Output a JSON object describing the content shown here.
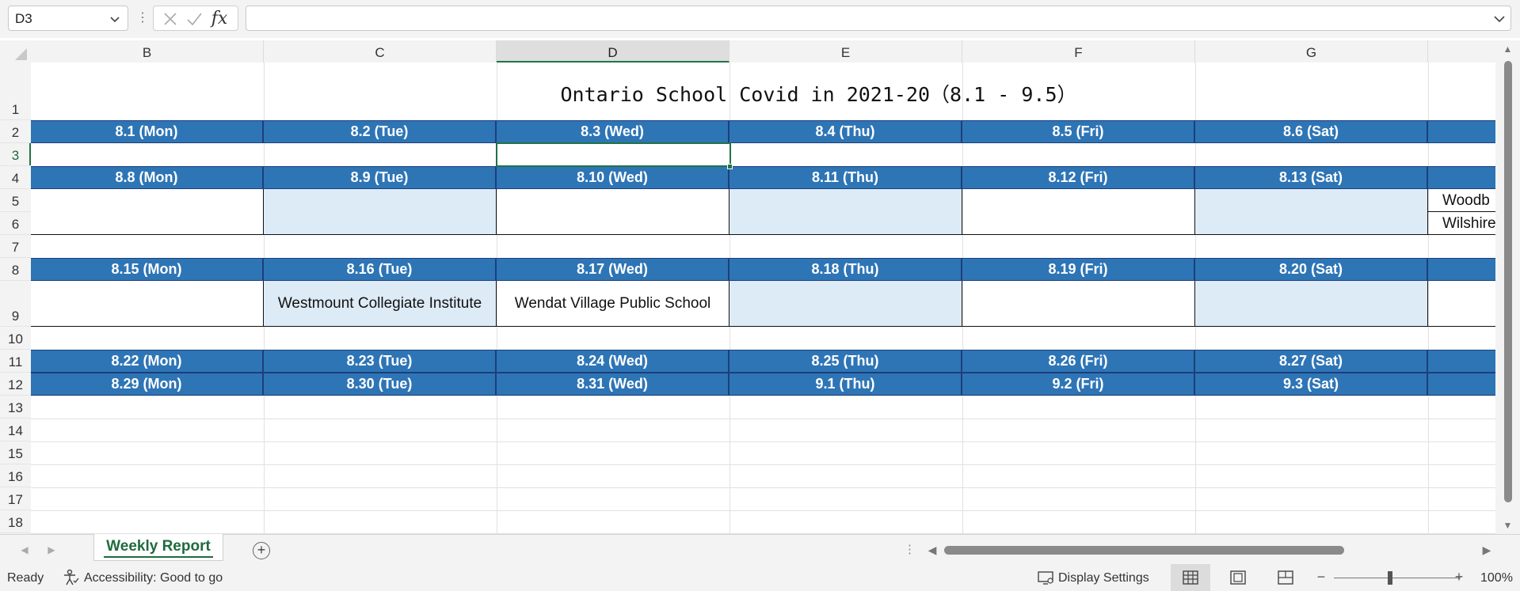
{
  "formula_bar": {
    "name_box": "D3",
    "fx_label": "fx",
    "formula_value": ""
  },
  "columns": [
    "B",
    "C",
    "D",
    "E",
    "F",
    "G"
  ],
  "rows": [
    "1",
    "2",
    "3",
    "4",
    "5",
    "6",
    "7",
    "8",
    "9",
    "10",
    "11",
    "12",
    "13",
    "14",
    "15",
    "16",
    "17",
    "18"
  ],
  "selected_cell": "D3",
  "sheet": {
    "title": "Ontario School Covid in 2021-20（8.1 - 9.5）",
    "week1": [
      "8.1 (Mon)",
      "8.2 (Tue)",
      "8.3 (Wed)",
      "8.4 (Thu)",
      "8.5 (Fri)",
      "8.6 (Sat)"
    ],
    "week2": [
      "8.8 (Mon)",
      "8.9 (Tue)",
      "8.10 (Wed)",
      "8.11 (Thu)",
      "8.12 (Fri)",
      "8.13 (Sat)"
    ],
    "week2_overflow": [
      "Woodb",
      "Wilshire"
    ],
    "week3": [
      "8.15 (Mon)",
      "8.16 (Tue)",
      "8.17 (Wed)",
      "8.18 (Thu)",
      "8.19 (Fri)",
      "8.20 (Sat)"
    ],
    "week3_entries": [
      "",
      "Westmount Collegiate Institute",
      "Wendat Village Public School",
      "",
      "",
      ""
    ],
    "week4": [
      "8.22 (Mon)",
      "8.23 (Tue)",
      "8.24 (Wed)",
      "8.25 (Thu)",
      "8.26 (Fri)",
      "8.27 (Sat)"
    ],
    "week5": [
      "8.29 (Mon)",
      "8.30 (Tue)",
      "8.31 (Wed)",
      "9.1 (Thu)",
      "9.2 (Fri)",
      "9.3 (Sat)"
    ]
  },
  "sheet_tabs": [
    "Weekly Report"
  ],
  "status_bar": {
    "ready": "Ready",
    "accessibility": "Accessibility: Good to go",
    "display_settings": "Display Settings",
    "zoom": "100%"
  },
  "colors": {
    "header_fill": "#2e75b6",
    "shade_fill": "#ddebf7",
    "accent_green": "#217346"
  },
  "icons": [
    "chevron-down-icon",
    "cancel-icon",
    "enter-icon",
    "function-icon",
    "accessibility-icon",
    "display-settings-icon",
    "normal-view-icon",
    "page-layout-icon",
    "page-break-icon",
    "add-sheet-icon"
  ]
}
